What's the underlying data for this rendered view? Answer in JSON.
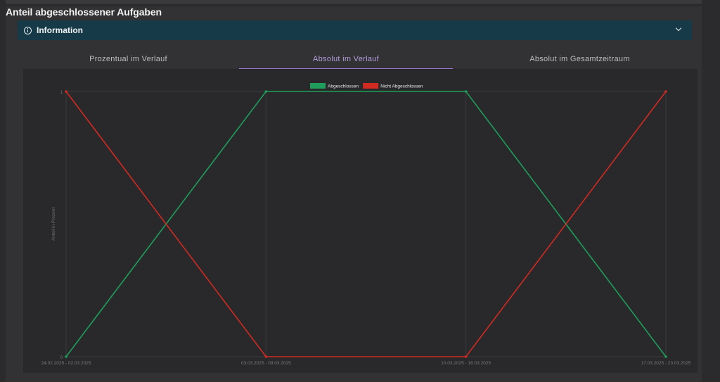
{
  "panel": {
    "title": "Anteil abgeschlossener Aufgaben"
  },
  "info": {
    "label": "Information",
    "icon": "info-circle-icon",
    "toggle_icon": "chevron-down-icon"
  },
  "tabs": [
    {
      "label": "Prozentual im Verlauf",
      "active": false
    },
    {
      "label": "Absolut im Verlauf",
      "active": true
    },
    {
      "label": "Absolut im Gesamtzeitraum",
      "active": false
    }
  ],
  "colors": {
    "accent": "#9575cd",
    "info_bg": "#163a47",
    "green": "#1e9e5a",
    "red": "#d12a22"
  },
  "chart_data": {
    "type": "line",
    "categories": [
      "24.02.2025 - 02.03.2025",
      "03.03.2025 - 09.03.2025",
      "10.03.2025 - 16.03.2025",
      "17.03.2025 - 23.03.2025"
    ],
    "series": [
      {
        "name": "Abgeschlossen",
        "color": "#1e9e5a",
        "values": [
          0,
          1,
          1,
          0
        ]
      },
      {
        "name": "Nicht Abgeschlossen",
        "color": "#d12a22",
        "values": [
          1,
          0,
          0,
          1
        ]
      }
    ],
    "ylabel": "Anteil in Prozent",
    "xlabel": "",
    "ylim": [
      0,
      1
    ],
    "yticks": [
      "0",
      "1"
    ],
    "legend": "top-center",
    "grid": true
  }
}
